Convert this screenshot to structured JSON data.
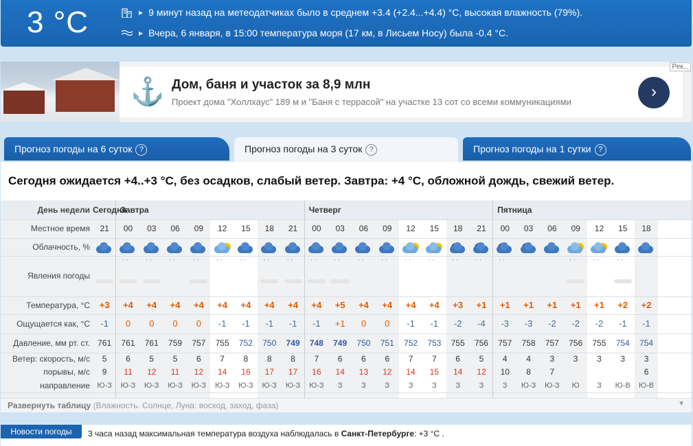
{
  "current": {
    "temperature": "3 °C",
    "station_note": "9 минут назад на метеодатчиках было в среднем +3.4 (+2.4...+4.4) °С, высокая влажность (79%).",
    "sea_note": "Вчера, 6 января, в 15:00 температура моря (17 км, в Лисьем Носу) была -0.4 °С."
  },
  "ad": {
    "title": "Дом, баня и участок за 8,9 млн",
    "description": "Проект дома \"Холлхаус\" 189 м и \"Баня с террасой\" на участке 13 сот со всеми коммуникациями",
    "label": "Рек..."
  },
  "tabs": [
    {
      "label": "Прогноз погоды на 6 суток",
      "help": "?"
    },
    {
      "label": "Прогноз погоды на 3 суток",
      "help": "?"
    },
    {
      "label": "Прогноз погоды на 1 сутки",
      "help": "?"
    }
  ],
  "summary": "Сегодня ожидается +4..+3 °С, без осадков, слабый ветер. Завтра: +4 °С, обложной дождь, свежий ветер.",
  "table": {
    "row_labels": {
      "day": "День недели",
      "time": "Местное время",
      "cloud": "Облачность, %",
      "phenomena": "Явления погоды",
      "temp": "Температура, °С",
      "feels": "Ощущается как, °С",
      "pressure": "Давление, мм рт. ст.",
      "wind": "Ветер: скорость, м/с",
      "gusts": "порывы, м/с",
      "direction": "направление"
    },
    "days": [
      "Сегодня",
      "Завтра",
      "Четверг",
      "Пятница"
    ],
    "times": [
      "21",
      "00",
      "03",
      "06",
      "09",
      "12",
      "15",
      "18",
      "21",
      "00",
      "03",
      "06",
      "09",
      "12",
      "15",
      "18",
      "21",
      "00",
      "03",
      "06",
      "09",
      "12",
      "15",
      "18"
    ],
    "temps": [
      "+3",
      "+4",
      "+4",
      "+4",
      "+4",
      "+4",
      "+4",
      "+4",
      "+4",
      "+4",
      "+5",
      "+4",
      "+4",
      "+4",
      "+4",
      "+3",
      "+1",
      "+1",
      "+1",
      "+1",
      "+1",
      "+1",
      "+2",
      "+2"
    ],
    "feels": [
      "-1",
      "0",
      "0",
      "0",
      "0",
      "-1",
      "-1",
      "-1",
      "-1",
      "-1",
      "+1",
      "0",
      "0",
      "-1",
      "-1",
      "-2",
      "-4",
      "-3",
      "-3",
      "-2",
      "-2",
      "-2",
      "-1",
      "-1"
    ],
    "pressure": [
      "761",
      "761",
      "761",
      "759",
      "757",
      "755",
      "752",
      "750",
      "749",
      "748",
      "749",
      "750",
      "751",
      "752",
      "753",
      "755",
      "756",
      "757",
      "758",
      "757",
      "756",
      "755",
      "754",
      "754"
    ],
    "wind": [
      "5",
      "6",
      "5",
      "5",
      "6",
      "7",
      "8",
      "8",
      "8",
      "7",
      "6",
      "6",
      "6",
      "7",
      "7",
      "6",
      "5",
      "4",
      "4",
      "3",
      "3",
      "3",
      "3",
      "3"
    ],
    "gusts": [
      "9",
      "11",
      "12",
      "11",
      "12",
      "14",
      "16",
      "17",
      "17",
      "16",
      "14",
      "13",
      "12",
      "14",
      "15",
      "14",
      "12",
      "10",
      "8",
      "7",
      "",
      "",
      "",
      "6"
    ],
    "direction": [
      "Ю-З",
      "Ю-З",
      "Ю-З",
      "Ю-З",
      "Ю-З",
      "Ю-З",
      "Ю-З",
      "Ю-З",
      "Ю-З",
      "Ю-З",
      "З",
      "З",
      "З",
      "З",
      "З",
      "З",
      "З",
      "З",
      "Ю-З",
      "Ю-З",
      "Ю",
      "З",
      "Ю-В",
      "Ю-В"
    ]
  },
  "expand": {
    "label": "Развернуть таблицу",
    "hint": "(Влажность. Солнце, Луна: восход, заход, фаза)"
  },
  "news": {
    "tag": "Новости погоды",
    "text_pre": "3 часа назад максимальная температура воздуха наблюдалась в",
    "city": "Санкт-Петербурге",
    "text_post": ": +3 °С ."
  },
  "colors": {
    "accent": "#1a64b1",
    "positive_temp": "#e05a00",
    "negative_temp": "#4a6a9a",
    "pressure_low": "#2c5aa0"
  }
}
